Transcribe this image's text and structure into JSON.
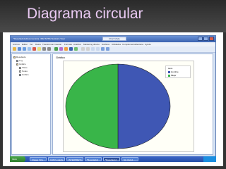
{
  "slide": {
    "title": "Diagrama circular"
  },
  "window": {
    "title": "*Resultado1 [Documento1] - IBM SPSS Statistics Visor",
    "mode_label": "Chart Mode"
  },
  "menu": [
    "Archivo",
    "Editar",
    "Ver",
    "Datos",
    "Transformar",
    "Insertar",
    "Formato",
    "Analizar",
    "Marketing directo",
    "Gráficos",
    "Utilidades",
    "Complementos",
    "Ventana",
    "Ayuda"
  ],
  "outline": {
    "items": [
      {
        "label": "Resultado",
        "indent": 0,
        "icon": "folder-icon"
      },
      {
        "label": "Log",
        "indent": 1,
        "icon": "log-icon"
      },
      {
        "label": "Gráfico",
        "indent": 1,
        "icon": "folder-icon"
      },
      {
        "label": "Título",
        "indent": 2,
        "icon": "page-icon"
      },
      {
        "label": "Notas",
        "indent": 2,
        "icon": "page-icon"
      },
      {
        "label": "Gráfico",
        "indent": 2,
        "icon": "chart-icon"
      }
    ]
  },
  "content": {
    "heading": "Gráfico"
  },
  "chart_data": {
    "type": "pie",
    "legend_title": "sexo",
    "legend_position": "top-right",
    "slices": [
      {
        "label": "Hombre",
        "value": 50,
        "color": "#3f57b4"
      },
      {
        "label": "Mujer",
        "value": 50,
        "color": "#39b549"
      }
    ]
  },
  "status": {
    "text": "IBM SPSS Statistics Processor está listo",
    "right": "Unicode: ON"
  },
  "taskbar": {
    "start": "Inicio",
    "tasks": [
      "Clases Virtu...",
      "CAP2 estadis...",
      "INTERPRETA...",
      "*Resultado1 ...",
      "*Resultado1 ...",
      "Sin título1 ..."
    ]
  },
  "colors": {
    "title": "#e9c9f2",
    "window_accent": "#3a62b0",
    "pie_left": "#39b549",
    "pie_right": "#3f57b4"
  }
}
